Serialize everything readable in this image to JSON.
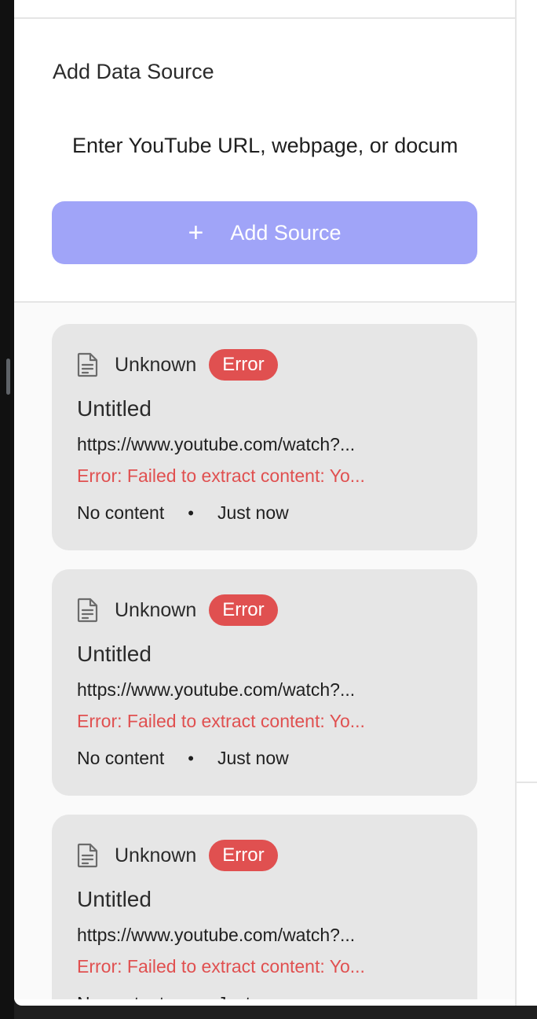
{
  "add_source": {
    "title": "Add Data Source",
    "input_placeholder": "Enter YouTube URL, webpage, or document link",
    "button_label": "Add Source",
    "button_color": "#a0a4f8"
  },
  "sources": [
    {
      "type": "Unknown",
      "status": "Error",
      "title": "Untitled",
      "url": "https://www.youtube.com/watch?...",
      "error": "Error: Failed to extract content: Yo...",
      "content": "No content",
      "separator": "•",
      "time": "Just now",
      "icon": "document-icon"
    },
    {
      "type": "Unknown",
      "status": "Error",
      "title": "Untitled",
      "url": "https://www.youtube.com/watch?...",
      "error": "Error: Failed to extract content: Yo...",
      "content": "No content",
      "separator": "•",
      "time": "Just now",
      "icon": "document-icon"
    },
    {
      "type": "Unknown",
      "status": "Error",
      "title": "Untitled",
      "url": "https://www.youtube.com/watch?...",
      "error": "Error: Failed to extract content: Yo...",
      "content": "No content",
      "separator": "•",
      "time": "Just now",
      "icon": "document-icon"
    }
  ],
  "colors": {
    "error": "#e05050",
    "card_background": "#e6e6e6"
  }
}
